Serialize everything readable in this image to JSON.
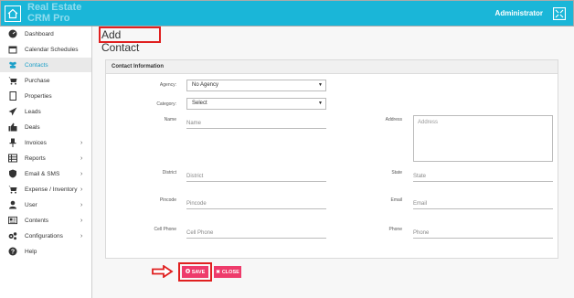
{
  "header": {
    "brand_line1": "Real Estate",
    "brand_line2": "CRM Pro",
    "user": "Administrator"
  },
  "sidebar": {
    "items": [
      {
        "label": "Dashboard",
        "icon": "dashboard-icon"
      },
      {
        "label": "Calendar Schedules",
        "icon": "calendar-icon"
      },
      {
        "label": "Contacts",
        "icon": "users-icon",
        "active": true
      },
      {
        "label": "Purchase",
        "icon": "cart-icon"
      },
      {
        "label": "Properties",
        "icon": "document-icon"
      },
      {
        "label": "Leads",
        "icon": "paper-plane-icon"
      },
      {
        "label": "Deals",
        "icon": "thumbs-up-icon"
      },
      {
        "label": "Invoices",
        "icon": "pin-icon",
        "has_children": true
      },
      {
        "label": "Reports",
        "icon": "table-icon",
        "has_children": true
      },
      {
        "label": "Email & SMS",
        "icon": "shield-icon",
        "has_children": true
      },
      {
        "label": "Expense / Inventory",
        "icon": "cart-icon",
        "has_children": true
      },
      {
        "label": "User",
        "icon": "user-icon",
        "has_children": true
      },
      {
        "label": "Contents",
        "icon": "contents-icon",
        "has_children": true
      },
      {
        "label": "Configurations",
        "icon": "cogs-icon",
        "has_children": true
      },
      {
        "label": "Help",
        "icon": "help-icon"
      }
    ]
  },
  "page": {
    "title": "Add Contact",
    "panel_title": "Contact Information"
  },
  "form": {
    "agency": {
      "label": "Agency:",
      "value": "No Agency"
    },
    "category": {
      "label": "Category:",
      "value": "Select"
    },
    "name": {
      "label": "Name",
      "placeholder": "Name"
    },
    "address": {
      "label": "Address",
      "placeholder": "Address"
    },
    "district": {
      "label": "District",
      "placeholder": "District"
    },
    "state": {
      "label": "State",
      "placeholder": "State"
    },
    "pincode": {
      "label": "Pincode",
      "placeholder": "Pincode"
    },
    "email": {
      "label": "Email",
      "placeholder": "Email"
    },
    "cell_phone": {
      "label": "Cell Phone",
      "placeholder": "Cell Phone"
    },
    "phone": {
      "label": "Phone",
      "placeholder": "Phone"
    }
  },
  "actions": {
    "save_label": "SAVE",
    "close_label": "CLOSE"
  },
  "colors": {
    "topbar": "#1ab6d8",
    "accent_button": "#ee3b6b",
    "highlight": "#e02020",
    "active_item": "#1a9fc8"
  }
}
